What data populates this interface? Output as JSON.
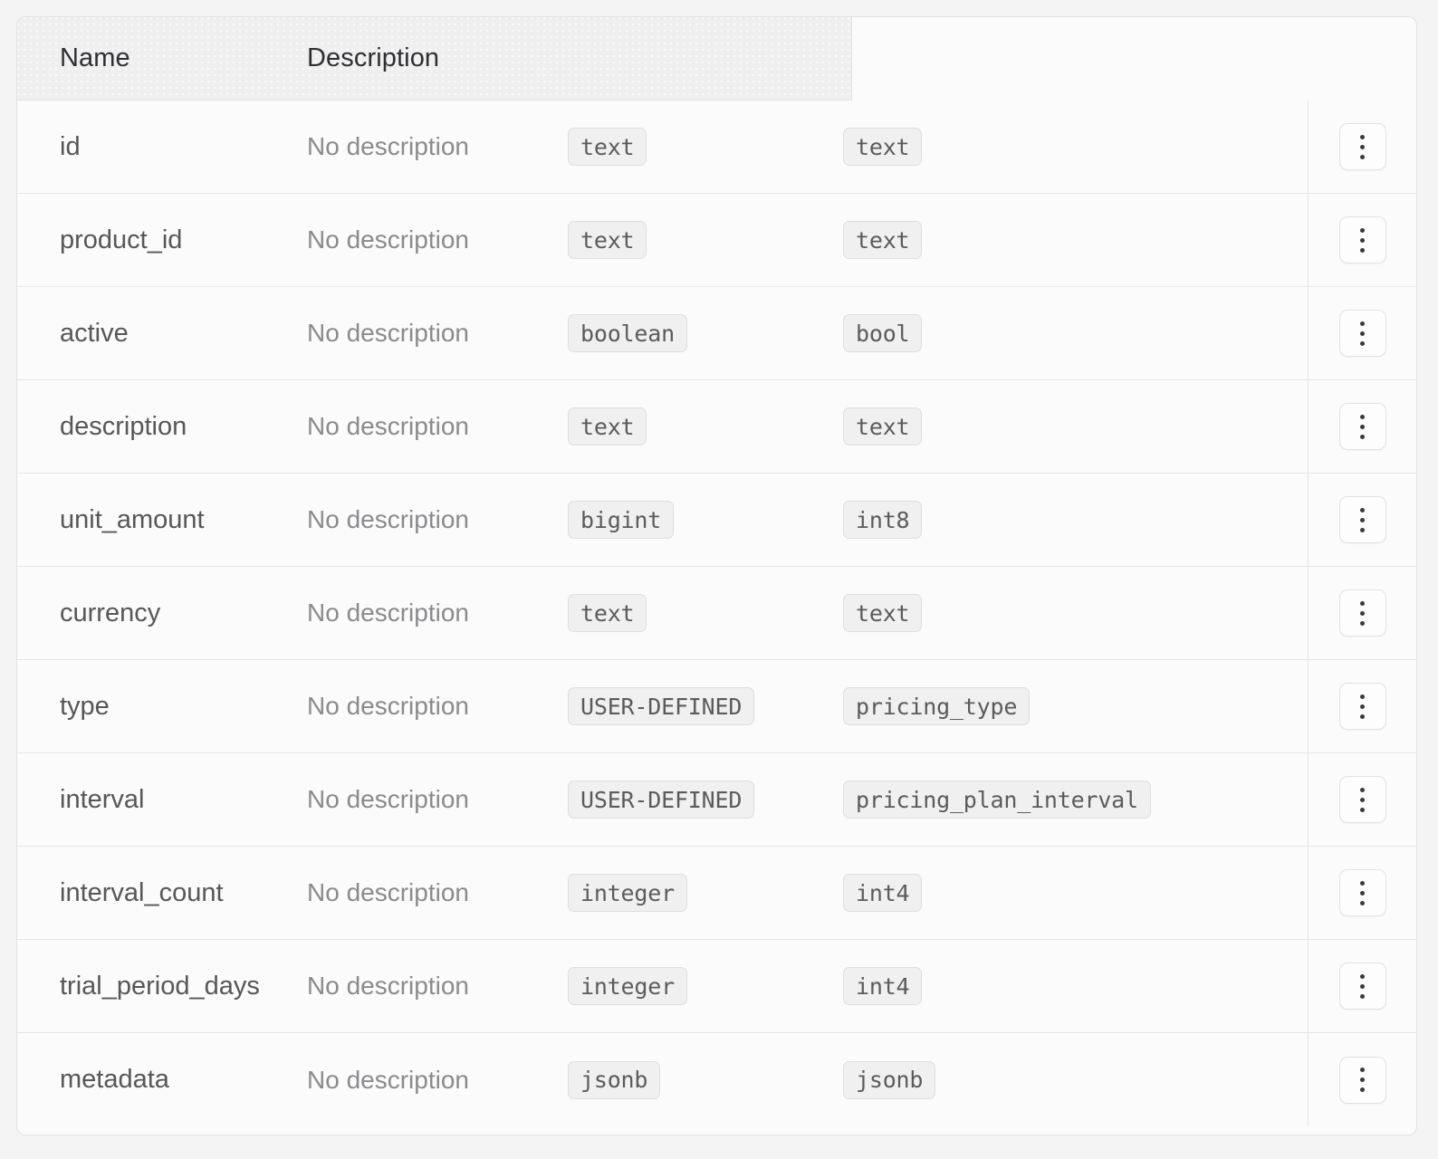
{
  "table": {
    "headers": {
      "name": "Name",
      "description": "Description"
    },
    "row_action_icon": "vertical-ellipsis-icon",
    "colors": {
      "page_background": "#f4f4f5",
      "card_background": "#fbfbfb",
      "header_background": "#efefef",
      "border": "#e3e3e3",
      "row_divider": "#e6e6e6",
      "name_text": "#575757",
      "description_text": "#8b8b8e",
      "badge_background": "#f0f0f0",
      "badge_border": "#dedede",
      "badge_text": "#5b5b5e",
      "header_text": "#2f2f33"
    },
    "rows": [
      {
        "name": "id",
        "description": "No description",
        "format": "text",
        "type": "text"
      },
      {
        "name": "product_id",
        "description": "No description",
        "format": "text",
        "type": "text"
      },
      {
        "name": "active",
        "description": "No description",
        "format": "boolean",
        "type": "bool"
      },
      {
        "name": "description",
        "description": "No description",
        "format": "text",
        "type": "text"
      },
      {
        "name": "unit_amount",
        "description": "No description",
        "format": "bigint",
        "type": "int8"
      },
      {
        "name": "currency",
        "description": "No description",
        "format": "text",
        "type": "text"
      },
      {
        "name": "type",
        "description": "No description",
        "format": "USER-DEFINED",
        "type": "pricing_type"
      },
      {
        "name": "interval",
        "description": "No description",
        "format": "USER-DEFINED",
        "type": "pricing_plan_interval"
      },
      {
        "name": "interval_count",
        "description": "No description",
        "format": "integer",
        "type": "int4"
      },
      {
        "name": "trial_period_days",
        "description": "No description",
        "format": "integer",
        "type": "int4"
      },
      {
        "name": "metadata",
        "description": "No description",
        "format": "jsonb",
        "type": "jsonb"
      }
    ]
  }
}
